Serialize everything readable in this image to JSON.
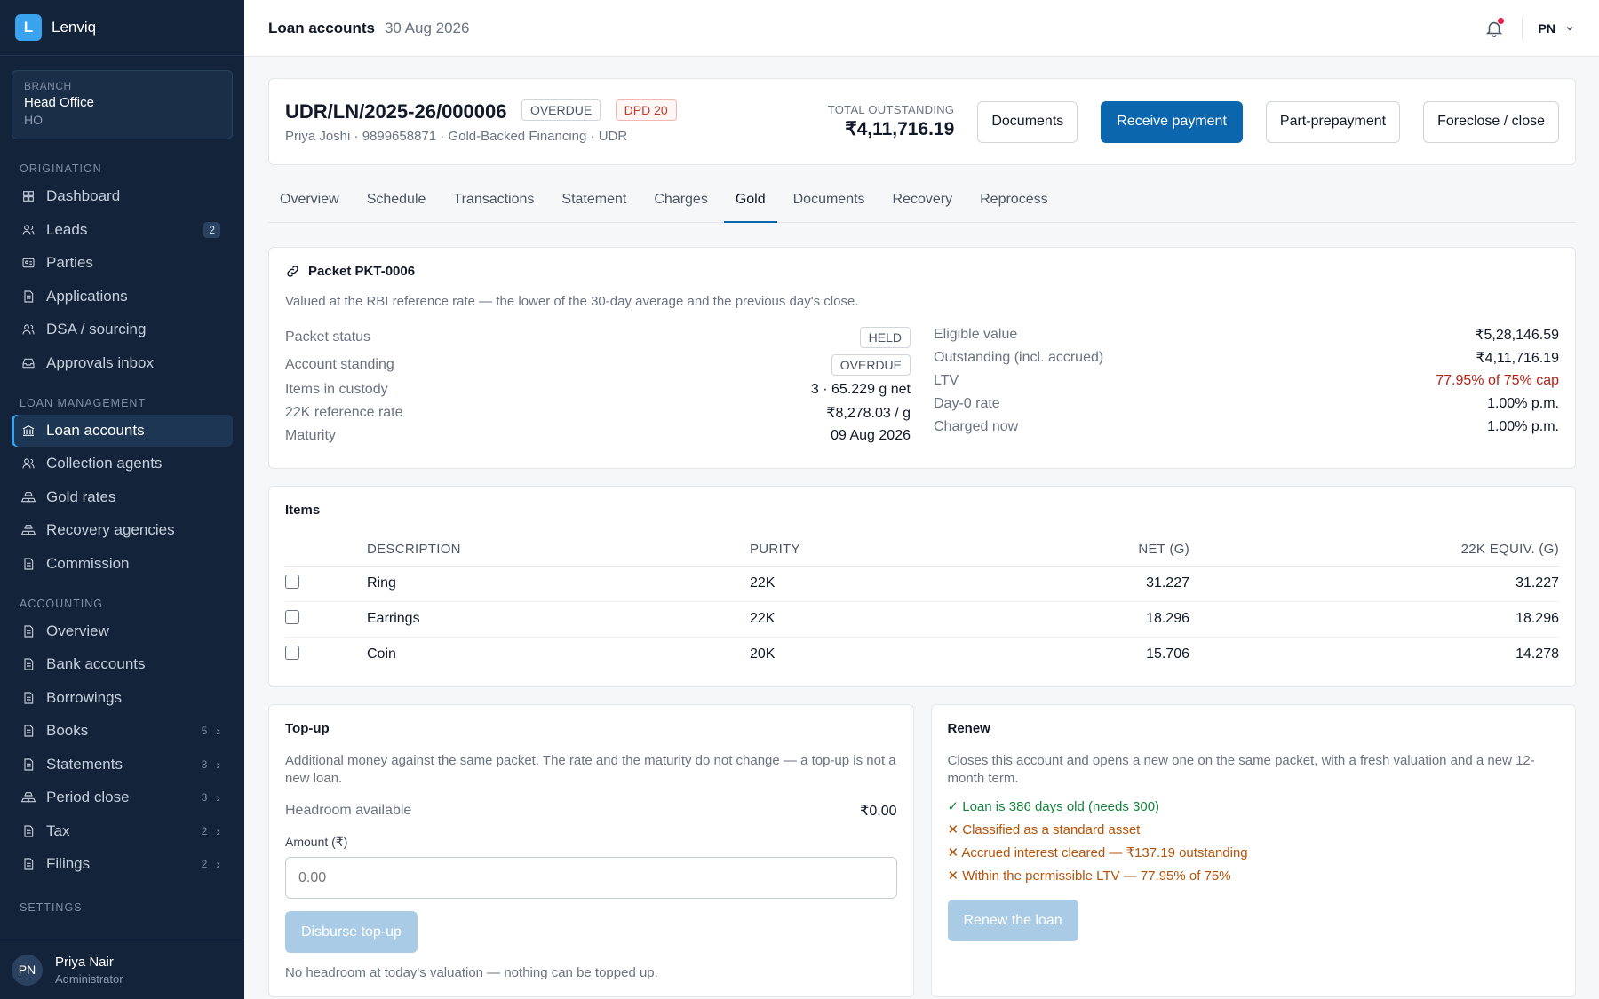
{
  "brand": {
    "logo_letter": "L",
    "name": "Lenviq"
  },
  "branch": {
    "label": "BRANCH",
    "name": "Head Office",
    "code": "HO"
  },
  "sidebar": {
    "origination_title": "ORIGINATION",
    "origination": [
      {
        "label": "Dashboard",
        "icon": "dashboard-icon"
      },
      {
        "label": "Leads",
        "icon": "users-icon",
        "badge": "2"
      },
      {
        "label": "Parties",
        "icon": "id-card-icon"
      },
      {
        "label": "Applications",
        "icon": "document-icon"
      },
      {
        "label": "DSA / sourcing",
        "icon": "users-icon"
      },
      {
        "label": "Approvals inbox",
        "icon": "inbox-icon"
      }
    ],
    "loan_title": "LOAN MANAGEMENT",
    "loan": [
      {
        "label": "Loan accounts",
        "icon": "bank-icon",
        "active": true
      },
      {
        "label": "Collection agents",
        "icon": "users-icon"
      },
      {
        "label": "Gold rates",
        "icon": "gold-icon"
      },
      {
        "label": "Recovery agencies",
        "icon": "gold-icon"
      },
      {
        "label": "Commission",
        "icon": "document-icon"
      }
    ],
    "accounting_title": "ACCOUNTING",
    "accounting": [
      {
        "label": "Overview",
        "icon": "document-icon"
      },
      {
        "label": "Bank accounts",
        "icon": "document-icon"
      },
      {
        "label": "Borrowings",
        "icon": "document-icon"
      },
      {
        "label": "Books",
        "icon": "document-icon",
        "count": "5"
      },
      {
        "label": "Statements",
        "icon": "document-icon",
        "count": "3"
      },
      {
        "label": "Period close",
        "icon": "gold-icon",
        "count": "3"
      },
      {
        "label": "Tax",
        "icon": "document-icon",
        "count": "2"
      },
      {
        "label": "Filings",
        "icon": "document-icon",
        "count": "2"
      }
    ],
    "settings_title": "SETTINGS"
  },
  "user": {
    "initials": "PN",
    "name": "Priya Nair",
    "role": "Administrator"
  },
  "topbar": {
    "title": "Loan accounts",
    "date": "30 Aug 2026",
    "initials": "PN"
  },
  "account": {
    "id": "UDR/LN/2025-26/000006",
    "status": "OVERDUE",
    "dpd": "DPD 20",
    "subtitle": "Priya Joshi · 9899658871 · Gold-Backed Financing · UDR",
    "total_label": "TOTAL OUTSTANDING",
    "total_value": "₹4,11,716.19",
    "btn_documents": "Documents",
    "btn_receive": "Receive payment",
    "btn_prepay": "Part-prepayment",
    "btn_foreclose": "Foreclose / close"
  },
  "tabs": [
    "Overview",
    "Schedule",
    "Transactions",
    "Statement",
    "Charges",
    "Gold",
    "Documents",
    "Recovery",
    "Reprocess"
  ],
  "active_tab": "Gold",
  "packet": {
    "title": "Packet PKT-0006",
    "desc": "Valued at the RBI reference rate — the lower of the 30-day average and the previous day's close.",
    "status_label": "Packet status",
    "status_value": "HELD",
    "standing_label": "Account standing",
    "standing_value": "OVERDUE",
    "items_label": "Items in custody",
    "items_value": "3 · 65.229 g net",
    "rate_label": "22K reference rate",
    "rate_value": "₹8,278.03 / g",
    "maturity_label": "Maturity",
    "maturity_value": "09 Aug 2026",
    "eligible_label": "Eligible value",
    "eligible_value": "₹5,28,146.59",
    "outstanding_label": "Outstanding (incl. accrued)",
    "outstanding_value": "₹4,11,716.19",
    "ltv_label": "LTV",
    "ltv_value": "77.95% of 75% cap",
    "day0_label": "Day-0 rate",
    "day0_value": "1.00% p.m.",
    "charged_label": "Charged now",
    "charged_value": "1.00% p.m."
  },
  "items": {
    "title": "Items",
    "headers": {
      "description": "DESCRIPTION",
      "purity": "PURITY",
      "net": "NET (G)",
      "equiv": "22K EQUIV. (G)"
    },
    "rows": [
      {
        "description": "Ring",
        "purity": "22K",
        "net": "31.227",
        "equiv": "31.227"
      },
      {
        "description": "Earrings",
        "purity": "22K",
        "net": "18.296",
        "equiv": "18.296"
      },
      {
        "description": "Coin",
        "purity": "20K",
        "net": "15.706",
        "equiv": "14.278"
      }
    ]
  },
  "topup": {
    "title": "Top-up",
    "desc": "Additional money against the same packet. The rate and the maturity do not change — a top-up is not a new loan.",
    "headroom_label": "Headroom available",
    "headroom_value": "₹0.00",
    "amount_label": "Amount (₹)",
    "amount_placeholder": "0.00",
    "button": "Disburse top-up",
    "note": "No headroom at today's valuation — nothing can be topped up."
  },
  "renew": {
    "title": "Renew",
    "desc": "Closes this account and opens a new one on the same packet, with a fresh valuation and a new 12-month term.",
    "checks": [
      {
        "text": "✓ Loan is 386 days old (needs 300)",
        "ok": true
      },
      {
        "text": "✕ Classified as a standard asset",
        "ok": false
      },
      {
        "text": "✕ Accrued interest cleared — ₹137.19 outstanding",
        "ok": false
      },
      {
        "text": "✕ Within the permissible LTV — 77.95% of 75%",
        "ok": false
      }
    ],
    "button": "Renew the loan"
  }
}
